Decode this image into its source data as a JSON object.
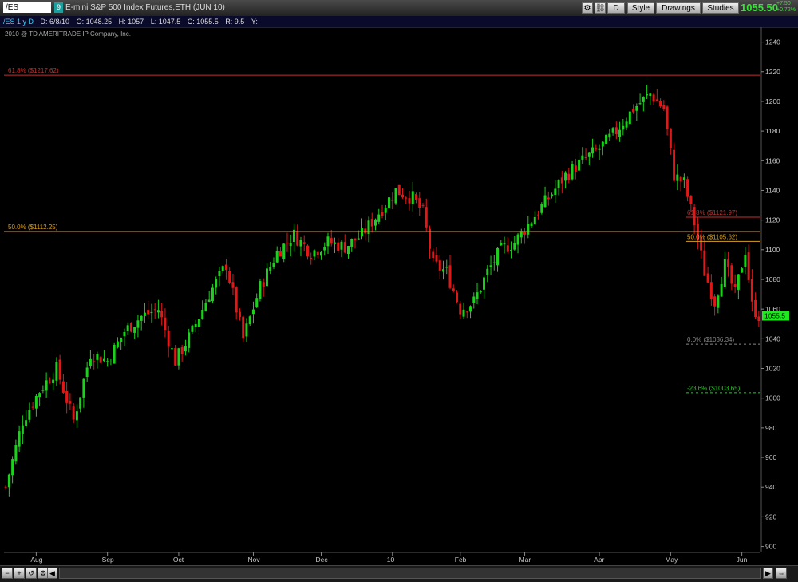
{
  "header": {
    "symbol": "/ES",
    "link_number": "9",
    "description": "E-mini S&P 500 Index Futures,ETH (JUN 10)",
    "buttons": {
      "period": "D",
      "style": "Style",
      "drawings": "Drawings",
      "studies": "Studies"
    },
    "last_price": "1055.50",
    "change": "+7.50",
    "change_pct": "+0.72%"
  },
  "infobar": {
    "symbol": "/ES 1 y D",
    "date": "D: 6/8/10",
    "open": "O: 1048.25",
    "high": "H: 1057",
    "low": "L: 1047.5",
    "close": "C: 1055.5",
    "range": "R: 9.5",
    "y": "Y:"
  },
  "copyright": "2010 @ TD AMERITRADE IP Company, Inc.",
  "chart_data": {
    "type": "candlestick",
    "title": "E-mini S&P 500 Index Futures,ETH (JUN 10)",
    "xlabel": "",
    "ylabel": "",
    "ylim": [
      896,
      1250
    ],
    "y_ticks": [
      900,
      920,
      940,
      960,
      980,
      1000,
      1020,
      1040,
      1060,
      1080,
      1100,
      1120,
      1140,
      1160,
      1180,
      1200,
      1220,
      1240
    ],
    "x_ticks": [
      {
        "label": "Aug",
        "idx": 9
      },
      {
        "label": "Sep",
        "idx": 30
      },
      {
        "label": "Oct",
        "idx": 51
      },
      {
        "label": "Nov",
        "idx": 73
      },
      {
        "label": "Dec",
        "idx": 93
      },
      {
        "label": "10",
        "idx": 114
      },
      {
        "label": "Feb",
        "idx": 134
      },
      {
        "label": "Mar",
        "idx": 153
      },
      {
        "label": "Apr",
        "idx": 175
      },
      {
        "label": "May",
        "idx": 196
      },
      {
        "label": "Jun",
        "idx": 217
      }
    ],
    "count": 223,
    "close_path": [
      [
        0,
        940
      ],
      [
        5,
        985
      ],
      [
        10,
        1005
      ],
      [
        15,
        1020
      ],
      [
        20,
        985
      ],
      [
        25,
        1030
      ],
      [
        30,
        1025
      ],
      [
        35,
        1045
      ],
      [
        40,
        1055
      ],
      [
        45,
        1060
      ],
      [
        50,
        1025
      ],
      [
        55,
        1045
      ],
      [
        60,
        1070
      ],
      [
        65,
        1090
      ],
      [
        70,
        1040
      ],
      [
        75,
        1075
      ],
      [
        80,
        1098
      ],
      [
        85,
        1110
      ],
      [
        90,
        1098
      ],
      [
        95,
        1105
      ],
      [
        100,
        1102
      ],
      [
        105,
        1110
      ],
      [
        110,
        1125
      ],
      [
        115,
        1140
      ],
      [
        120,
        1135
      ],
      [
        123,
        1125
      ],
      [
        126,
        1090
      ],
      [
        130,
        1085
      ],
      [
        134,
        1060
      ],
      [
        138,
        1065
      ],
      [
        142,
        1085
      ],
      [
        146,
        1100
      ],
      [
        150,
        1105
      ],
      [
        155,
        1120
      ],
      [
        160,
        1135
      ],
      [
        165,
        1150
      ],
      [
        170,
        1160
      ],
      [
        175,
        1168
      ],
      [
        180,
        1180
      ],
      [
        185,
        1195
      ],
      [
        190,
        1205
      ],
      [
        194,
        1195
      ],
      [
        197,
        1150
      ],
      [
        200,
        1145
      ],
      [
        203,
        1118
      ],
      [
        206,
        1085
      ],
      [
        209,
        1065
      ],
      [
        212,
        1090
      ],
      [
        215,
        1070
      ],
      [
        218,
        1100
      ],
      [
        220,
        1062
      ],
      [
        222,
        1055.5
      ]
    ],
    "current_price": 1055.5,
    "current_label": "1055.5",
    "fib_long": [
      {
        "label": "61.8%  ($1217.62)",
        "price": 1217.62,
        "color": "#c03030"
      },
      {
        "label": "50.0%  ($1112.25)",
        "price": 1112.25,
        "color": "#d8a020"
      }
    ],
    "fib_short": [
      {
        "label": "61.8%  ($1121.97)",
        "price": 1121.97,
        "color": "#c03030"
      },
      {
        "label": "50.0%  ($1105.62)",
        "price": 1105.62,
        "color": "#d8a020"
      },
      {
        "label": "0.0%  ($1036.34)",
        "price": 1036.34,
        "color": "#888888"
      },
      {
        "label": "-23.6%  ($1003.65)",
        "price": 1003.65,
        "color": "#22cc22"
      }
    ],
    "colors": {
      "up": "#1bd11b",
      "down": "#e01818",
      "axis": "#c8c8c8",
      "price_label_bg": "#1ee81e"
    }
  }
}
